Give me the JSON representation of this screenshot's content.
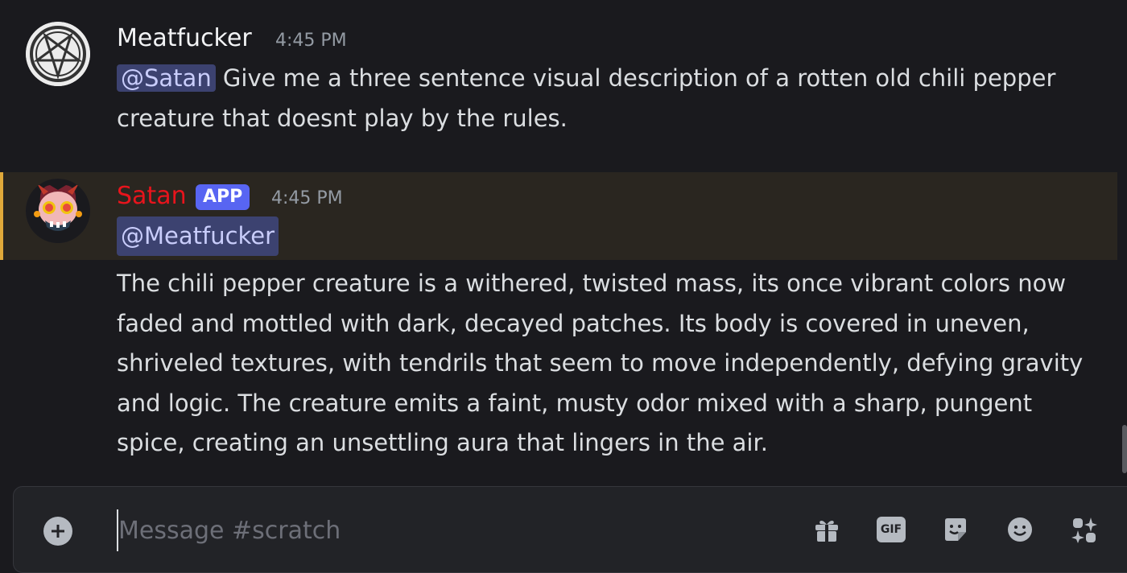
{
  "messages": [
    {
      "author": "Meatfucker",
      "time": "4:45 PM",
      "mention": "@Satan",
      "text": " Give me a three sentence visual description of a rotten old chili pepper creature that doesnt play by the rules."
    },
    {
      "author": "Satan",
      "badge": "APP",
      "time": "4:45 PM",
      "mention": "@Meatfucker",
      "text": "The chili pepper creature is a withered, twisted mass, its once vibrant colors now faded and mottled with dark, decayed patches. Its body is covered in uneven, shriveled textures, with tendrils that seem to move independently, defying gravity and logic. The creature emits a faint, musty odor mixed with a sharp, pungent spice, creating an unsettling aura that lingers in the air."
    }
  ],
  "composer": {
    "placeholder": "Message #scratch",
    "gif_label": "GIF"
  },
  "colors": {
    "mention_highlight": "#e0a93a",
    "app_badge": "#5865f2",
    "bot_name": "#e8141c"
  }
}
